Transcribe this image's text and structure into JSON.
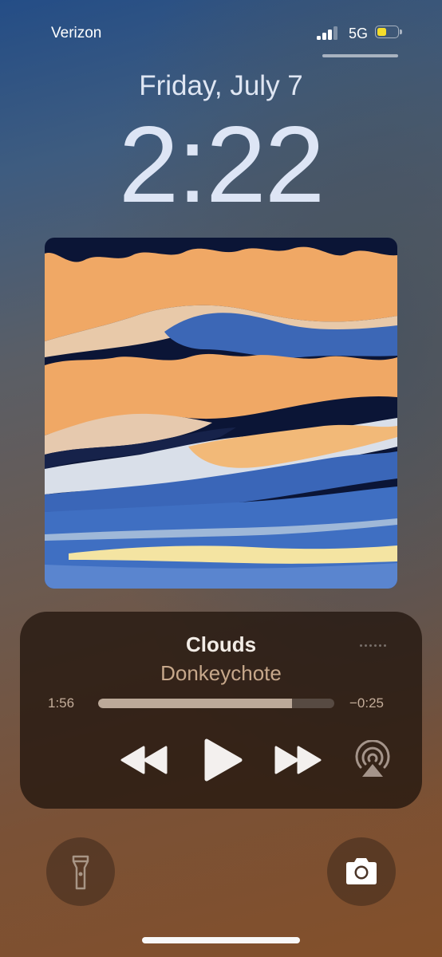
{
  "status_bar": {
    "carrier": "Verizon",
    "network": "5G",
    "signal_bars_active": 3,
    "signal_bars_total": 4,
    "battery_level": 0.45,
    "battery_color": "#f4dc2b"
  },
  "lock_screen": {
    "date": "Friday, July 7",
    "time": "2:22"
  },
  "now_playing": {
    "title": "Clouds",
    "artist": "Donkeychote",
    "elapsed": "1:56",
    "remaining": "−0:25",
    "progress": 0.82,
    "controls": [
      "rewind-icon",
      "play-icon",
      "fast-forward-icon",
      "airplay-icon"
    ],
    "more_icon": "ellipsis-icon"
  },
  "quick_actions": {
    "left": "flashlight-icon",
    "right": "camera-icon"
  },
  "colors": {
    "artist_text": "#c7a88b",
    "timestamp_text": "#c4ad9a",
    "artwork_orange": "#f0a865",
    "artwork_navy": "#0b1536",
    "artwork_blue": "#3a66b8"
  }
}
